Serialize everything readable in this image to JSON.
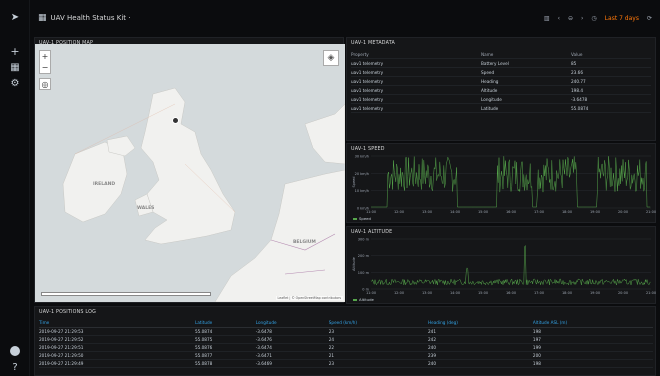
{
  "nav": {
    "dashboard_title": "UAV Health Status Kit ·",
    "icons": [
      "grafana-logo-icon",
      "plus-icon",
      "dashboards-icon",
      "gear-icon"
    ],
    "bottom_icons": [
      "avatar-icon",
      "help-icon"
    ]
  },
  "toolbar": {
    "time_range": "Last 7 days",
    "tz_label": "UTC",
    "icons": [
      "graph-icon",
      "chevron-left-icon",
      "zoom-out-icon",
      "chevron-right-icon",
      "clock-icon",
      "refresh-icon"
    ]
  },
  "map_panel": {
    "title": "UAV-1 POSITION MAP",
    "zoom_in": "+",
    "zoom_out": "−",
    "labels": {
      "ireland": "IRELAND",
      "belgium": "BELGIUM",
      "wales": "WALES"
    },
    "attribution": "Leaflet | © OpenStreetMap contributors"
  },
  "meta_panel": {
    "title": "UAV-1 METADATA",
    "headers": [
      "Property",
      "Name",
      "Value"
    ],
    "rows": [
      [
        "uav1 telemetry",
        "Battery Level",
        "85"
      ],
      [
        "uav1 telemetry",
        "Speed",
        "23.66"
      ],
      [
        "uav1 telemetry",
        "Heading",
        "240.77"
      ],
      [
        "uav1 telemetry",
        "Altitude",
        "198.4"
      ],
      [
        "uav1 telemetry",
        "Longitude",
        "-3.6478"
      ],
      [
        "uav1 telemetry",
        "Latitude",
        "55.0874"
      ]
    ]
  },
  "speed_panel": {
    "title": "UAV-1 SPEED",
    "legend": "Speed"
  },
  "alt_panel": {
    "title": "UAV-1 ALTITUDE",
    "legend": "Altitude"
  },
  "table_panel": {
    "title": "UAV-1 POSITIONS LOG",
    "headers": [
      "Time",
      "Latitude",
      "Longitude",
      "Speed (km/h)",
      "Heading (deg)",
      "Altitude ASL (m)"
    ],
    "rows": [
      [
        "2019-09-27 21:29:53",
        "55.0874",
        "-3.6478",
        "23",
        "241",
        "198"
      ],
      [
        "2019-09-27 21:29:52",
        "55.0875",
        "-3.6476",
        "24",
        "242",
        "197"
      ],
      [
        "2019-09-27 21:29:51",
        "55.0876",
        "-3.6474",
        "22",
        "240",
        "199"
      ],
      [
        "2019-09-27 21:29:50",
        "55.0877",
        "-3.6471",
        "21",
        "239",
        "200"
      ],
      [
        "2019-09-27 21:29:49",
        "55.0878",
        "-3.6469",
        "23",
        "240",
        "198"
      ]
    ]
  },
  "chart_data": [
    {
      "type": "line",
      "title": "UAV-1 SPEED",
      "ylabel": "Speed",
      "series": [
        {
          "name": "Speed",
          "color": "#56a64b"
        }
      ],
      "ytick_labels": [
        "30 km/h",
        "20 km/h",
        "10 km/h",
        "0 km/h"
      ],
      "xtick_labels": [
        "11:00",
        "12:00",
        "13:00",
        "14:00",
        "15:00",
        "16:00",
        "17:00",
        "18:00",
        "19:00",
        "20:00",
        "21:00"
      ]
    },
    {
      "type": "line",
      "title": "UAV-1 ALTITUDE",
      "ylabel": "Altitude",
      "series": [
        {
          "name": "Altitude",
          "color": "#56a64b"
        }
      ],
      "ytick_labels": [
        "300 m",
        "200 m",
        "100 m",
        "0 m"
      ],
      "xtick_labels": [
        "11:00",
        "12:00",
        "13:00",
        "14:00",
        "15:00",
        "16:00",
        "17:00",
        "18:00",
        "19:00",
        "20:00",
        "21:00"
      ]
    }
  ]
}
